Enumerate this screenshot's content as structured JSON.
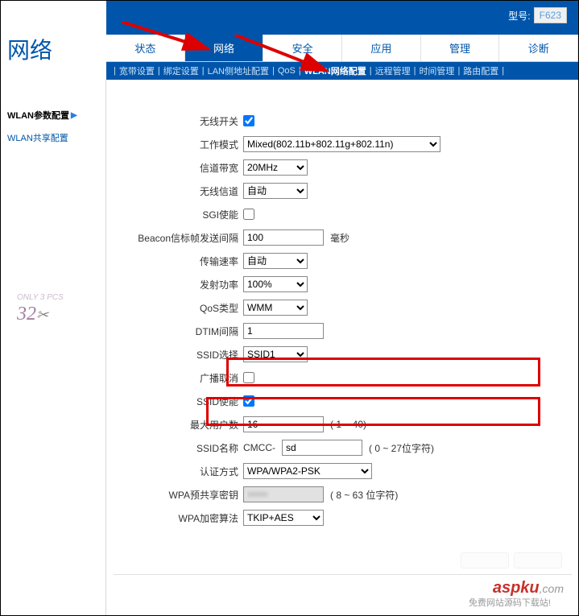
{
  "page_title": "网络",
  "model": {
    "label": "型号:",
    "value": "F623"
  },
  "main_tabs": [
    "状态",
    "网络",
    "安全",
    "应用",
    "管理",
    "诊断"
  ],
  "main_tab_active": 1,
  "sub_tabs": [
    "宽带设置",
    "绑定设置",
    "LAN侧地址配置",
    "QoS",
    "WLAN网络配置",
    "远程管理",
    "时间管理",
    "路由配置"
  ],
  "sub_tab_active": 4,
  "sidebar": {
    "items": [
      "WLAN参数配置",
      "WLAN共享配置"
    ],
    "active": 0
  },
  "form": {
    "wifi_switch": {
      "label": "无线开关",
      "checked": true
    },
    "work_mode": {
      "label": "工作模式",
      "value": "Mixed(802.11b+802.11g+802.11n)"
    },
    "bandwidth": {
      "label": "信道带宽",
      "value": "20MHz"
    },
    "channel": {
      "label": "无线信道",
      "value": "自动"
    },
    "sgi": {
      "label": "SGI使能",
      "checked": false
    },
    "beacon": {
      "label": "Beacon信标帧发送间隔",
      "value": "100",
      "unit": "毫秒"
    },
    "tx_rate": {
      "label": "传输速率",
      "value": "自动"
    },
    "tx_power": {
      "label": "发射功率",
      "value": "100%"
    },
    "qos": {
      "label": "QoS类型",
      "value": "WMM"
    },
    "dtim": {
      "label": "DTIM间隔",
      "value": "1"
    },
    "ssid_select": {
      "label": "SSID选择",
      "value": "SSID1"
    },
    "broadcast_cancel": {
      "label": "广播取消",
      "checked": false
    },
    "ssid_enable": {
      "label": "SSID使能",
      "checked": true
    },
    "max_users": {
      "label": "最大用户数",
      "value": "16",
      "hint": "( 1 ~ 40)"
    },
    "ssid_name": {
      "label": "SSID名称",
      "prefix": "CMCC-",
      "value": "sd",
      "hint": "( 0 ~ 27位字符)"
    },
    "auth_type": {
      "label": "认证方式",
      "value": "WPA/WPA2-PSK"
    },
    "wpa_key": {
      "label": "WPA预共享密钥",
      "value": "••••••",
      "hint": "( 8 ~ 63 位字符)"
    },
    "wpa_algo": {
      "label": "WPA加密算法",
      "value": "TKIP+AES"
    }
  },
  "watermark1": "32",
  "watermark2": {
    "text": "aspku",
    "suffix": ",com"
  },
  "footer": "免费网站源码下载站!"
}
